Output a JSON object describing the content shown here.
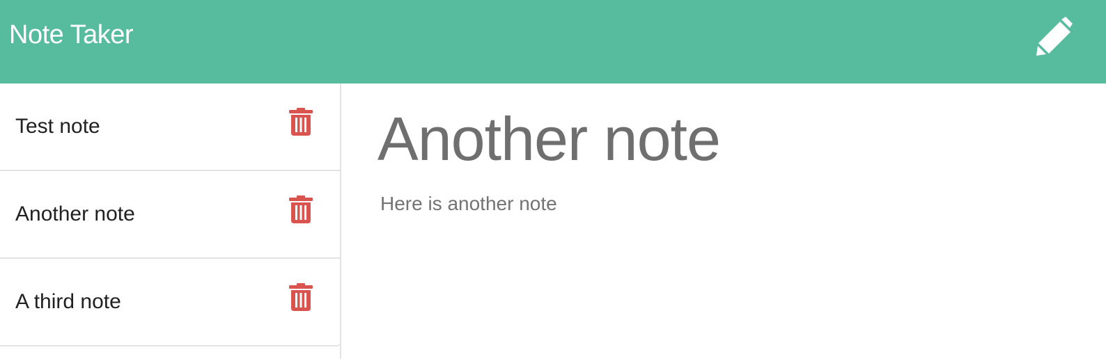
{
  "colors": {
    "navbar_bg": "#57bb9e",
    "delete_icon": "#d9534f",
    "note_title_text": "#6f6f6f"
  },
  "navbar": {
    "brand": "Note Taker",
    "new_note_icon": "pencil-icon"
  },
  "sidebar": {
    "notes": [
      {
        "title": "Test note",
        "delete_icon": "trash-icon"
      },
      {
        "title": "Another note",
        "delete_icon": "trash-icon"
      },
      {
        "title": "A third note",
        "delete_icon": "trash-icon"
      }
    ]
  },
  "editor": {
    "title_value": "Another note",
    "body_value": "Here is another note"
  }
}
